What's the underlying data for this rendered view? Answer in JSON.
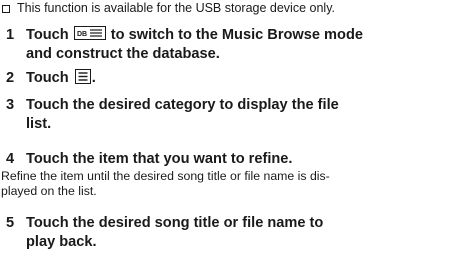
{
  "note": {
    "text": "This function is available for the USB storage device only.",
    "bullet_icon": "checkbox-square-icon"
  },
  "steps": [
    {
      "number": "1",
      "before_icon": "Touch ",
      "icon": "music-browse-db-icon",
      "line1_after": " to switch to the Music Browse mode",
      "line2": "and construct the database."
    },
    {
      "number": "2",
      "before_icon": "Touch ",
      "icon": "list-icon",
      "after_icon": "."
    },
    {
      "number": "3",
      "line1": "Touch the desired category to display the file",
      "line2": "list."
    },
    {
      "number": "4",
      "line1": "Touch the item that you want to refine.",
      "sub_line1": "Refine the item until the desired song title or file name is dis-",
      "sub_line2": "played on the list."
    },
    {
      "number": "5",
      "line1": "Touch the desired song title or file name to",
      "line2": "play back."
    }
  ]
}
